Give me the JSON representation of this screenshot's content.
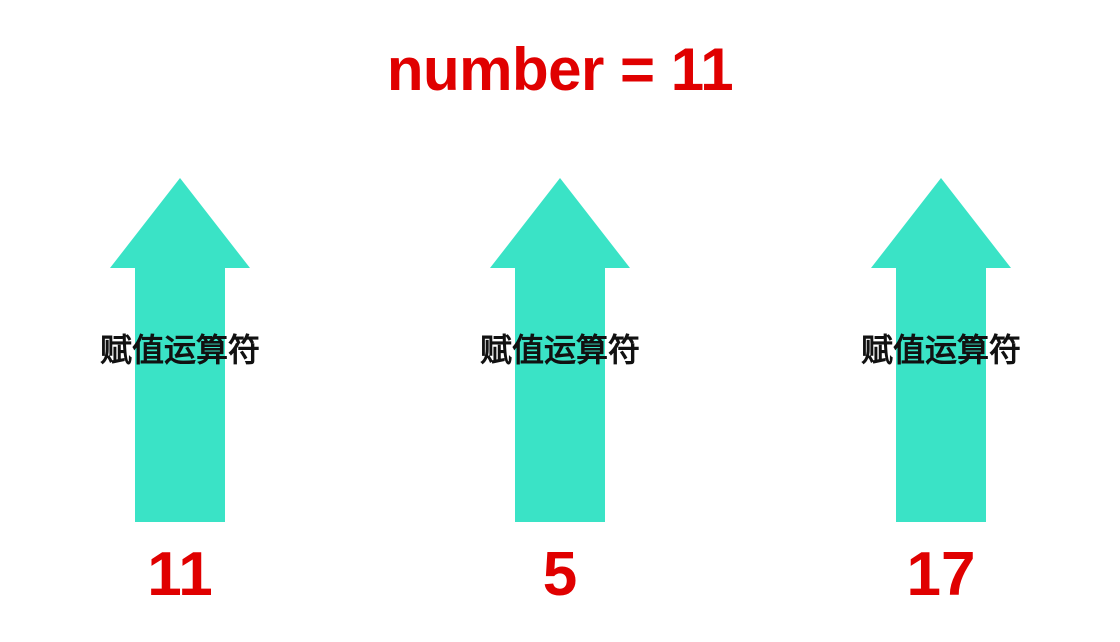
{
  "title": "number = 11",
  "colors": {
    "accent": "#e00000",
    "arrow": "#3ae3c6",
    "label": "#111111"
  },
  "arrows": [
    {
      "label": "赋值运算符",
      "value": "11"
    },
    {
      "label": "赋值运算符",
      "value": "5"
    },
    {
      "label": "赋值运算符",
      "value": "17"
    }
  ]
}
